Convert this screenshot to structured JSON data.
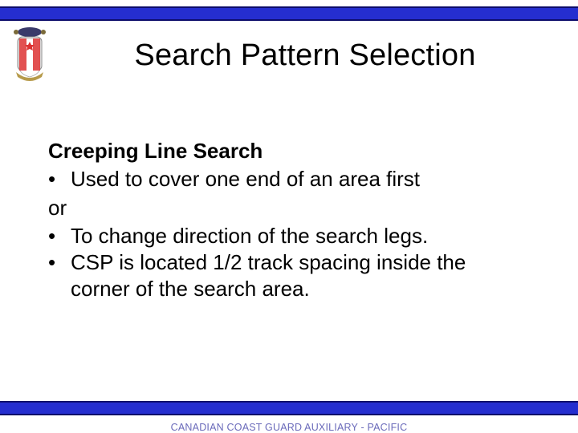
{
  "title": "Search Pattern Selection",
  "subheading": "Creeping Line Search",
  "bullets": {
    "b1": "Used to cover one end of an area first",
    "or": "or",
    "b2": "To change direction of the search legs.",
    "b3_line1": "CSP is located 1/2 track spacing inside the",
    "b3_line2": "corner of the search area."
  },
  "footer": "CANADIAN COAST GUARD AUXILIARY - PACIFIC",
  "icons": {
    "crest": "ccga-crest"
  }
}
